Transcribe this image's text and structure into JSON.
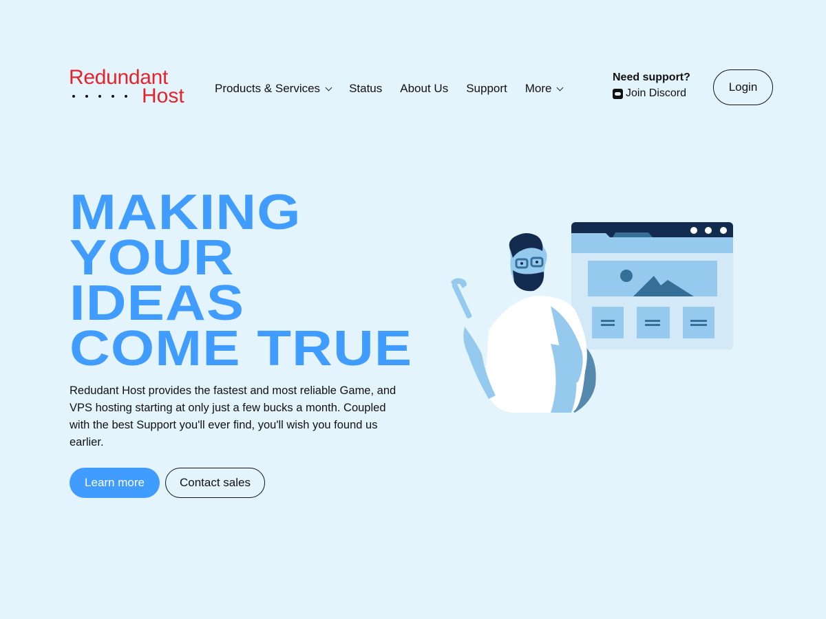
{
  "brand": {
    "line1": "Redundant",
    "line2": "Host",
    "color": "#E4232B"
  },
  "nav": {
    "items": [
      {
        "label": "Products & Services",
        "dropdown": true
      },
      {
        "label": "Status",
        "dropdown": false
      },
      {
        "label": "About Us",
        "dropdown": false
      },
      {
        "label": "Support",
        "dropdown": false
      },
      {
        "label": "More",
        "dropdown": true
      }
    ]
  },
  "support": {
    "heading": "Need support?",
    "link_label": "Join Discord",
    "icon": "discord-icon"
  },
  "header": {
    "login_label": "Login"
  },
  "hero": {
    "headline_lines": [
      "MAKING",
      "YOUR",
      "IDEAS",
      "COME TRUE"
    ],
    "accent_color": "#409CFF",
    "description": "Redudant Host provides the fastest and most reliable Game, and VPS hosting starting at only just a few bucks a month. Coupled with the best Support you'll ever find, you'll wish you found us earlier.",
    "primary_button": "Learn more",
    "secondary_button": "Contact sales"
  },
  "illustration": {
    "subject": "man-with-wrench-and-browser-window"
  },
  "colors": {
    "background": "#E3F4FD",
    "text": "#111111"
  }
}
